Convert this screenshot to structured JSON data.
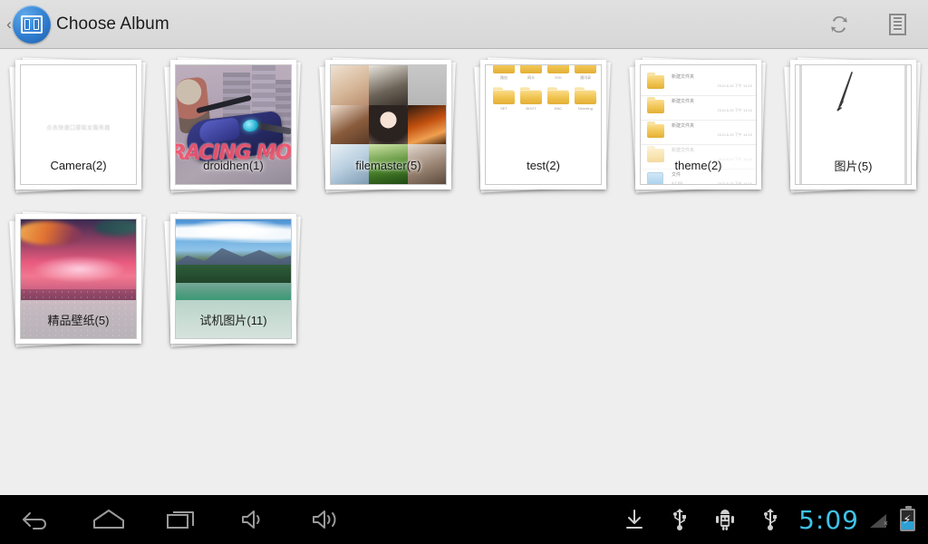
{
  "header": {
    "back_label": "‹",
    "title": "Choose Album",
    "app_icon": "album-app-icon",
    "refresh_icon": "refresh-icon",
    "list_icon": "list-view-icon"
  },
  "albums": [
    {
      "name": "Camera(2)",
      "thumb": "blank-white",
      "faint_text": "点击快速口提取女服务器",
      "label_band": false
    },
    {
      "name": "droidhen(1)",
      "thumb": "racing-moto",
      "overlay_text": "RACING MOTO",
      "label_band": false
    },
    {
      "name": "filemaster(5)",
      "thumb": "photo-grid-3x3",
      "label_band": false
    },
    {
      "name": "test(2)",
      "thumb": "folder-grid",
      "folder_captions": [
        "路由",
        "网卡",
        "STK",
        "通讯录",
        "SET",
        "BOOT",
        "DNC",
        "Directing"
      ],
      "label_band": false
    },
    {
      "name": "theme(2)",
      "thumb": "file-list",
      "rows": [
        {
          "icon": "folder",
          "name": "新建文件夹",
          "date": "2013-6-20  下午 14:10"
        },
        {
          "icon": "folder",
          "name": "新建文件夹",
          "date": "2013-6-20  下午 14:10"
        },
        {
          "icon": "folder",
          "name": "新建文件夹",
          "date": "2013-6-20  下午 14:10"
        },
        {
          "icon": "folder",
          "name": "新建文件夹",
          "date": "2013-6-20  下午 14:10"
        },
        {
          "icon": "file",
          "name": "文件",
          "sub": "4.2 KB",
          "date": "2013-6-20  下午 14:10"
        }
      ],
      "label_band": false
    },
    {
      "name": "图片(5)",
      "thumb": "white-scribble",
      "label_band": false
    },
    {
      "name": "精品壁纸(5)",
      "thumb": "sunset-city",
      "label_band": true
    },
    {
      "name": "试机图片(11)",
      "thumb": "mountain-lake",
      "label_band": true
    }
  ],
  "navbar": {
    "buttons": [
      {
        "name": "back-button",
        "icon": "back-arrow-icon"
      },
      {
        "name": "home-button",
        "icon": "home-icon"
      },
      {
        "name": "recents-button",
        "icon": "recents-icon"
      },
      {
        "name": "volume-down-button",
        "icon": "volume-down-icon"
      },
      {
        "name": "volume-up-button",
        "icon": "volume-up-icon"
      }
    ],
    "status": {
      "download_icon": "download-icon",
      "usb_icon": "usb-icon",
      "usb_debug_icon": "android-usb-debug-icon",
      "usb_icon_2": "usb-icon",
      "time": "5:09",
      "signal_icon": "no-signal-icon",
      "signal_x": "×",
      "battery_icon": "battery-charging-icon",
      "battery_bolt": "⚡",
      "battery_level_pct": 40
    },
    "clock_color": "#3fc3e8",
    "battery_color": "#2e9fd4"
  }
}
